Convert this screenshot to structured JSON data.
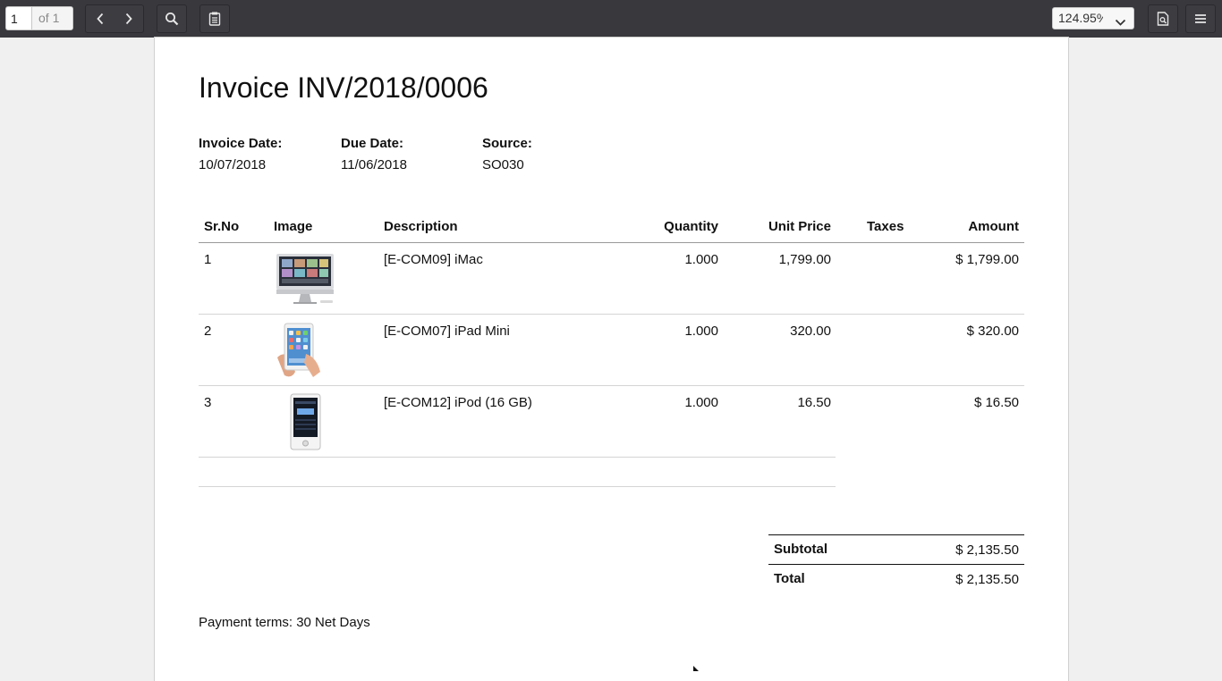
{
  "toolbar": {
    "page_number": "1",
    "page_total": "of 1",
    "zoom": "124.95%",
    "icons": [
      "chevron-left-icon",
      "chevron-right-icon",
      "search-icon",
      "document-outline-icon",
      "presentation-icon",
      "menu-icon"
    ]
  },
  "invoice": {
    "title": "Invoice INV/2018/0006",
    "invoice_date_label": "Invoice Date:",
    "invoice_date": "10/07/2018",
    "due_date_label": "Due Date:",
    "due_date": "11/06/2018",
    "source_label": "Source:",
    "source": "SO030"
  },
  "table": {
    "headers": {
      "no": "Sr.No",
      "image": "Image",
      "description": "Description",
      "quantity": "Quantity",
      "unit_price": "Unit Price",
      "taxes": "Taxes",
      "amount": "Amount"
    },
    "rows": [
      {
        "no": "1",
        "description": "[E-COM09] iMac",
        "quantity": "1.000",
        "unit_price": "1,799.00",
        "taxes": "",
        "amount": "$ 1,799.00",
        "image": "imac"
      },
      {
        "no": "2",
        "description": "[E-COM07] iPad Mini",
        "quantity": "1.000",
        "unit_price": "320.00",
        "taxes": "",
        "amount": "$ 320.00",
        "image": "ipad"
      },
      {
        "no": "3",
        "description": "[E-COM12] iPod (16 GB)",
        "quantity": "1.000",
        "unit_price": "16.50",
        "taxes": "",
        "amount": "$ 16.50",
        "image": "ipod"
      }
    ]
  },
  "totals": {
    "subtotal_label": "Subtotal",
    "subtotal": "$ 2,135.50",
    "total_label": "Total",
    "total": "$ 2,135.50"
  },
  "payment_terms": "Payment terms: 30 Net Days"
}
